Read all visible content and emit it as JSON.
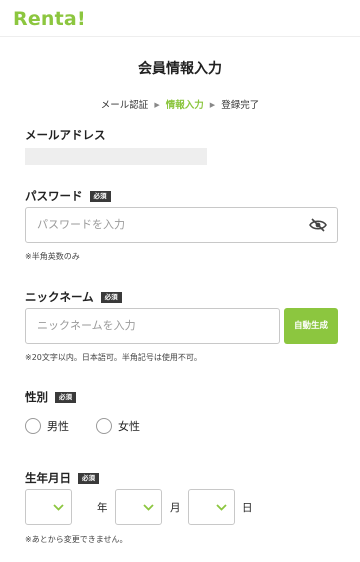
{
  "logo": {
    "text": "Renta!",
    "color": "#8cc63f"
  },
  "title": "会員情報入力",
  "steps": {
    "step1": "メール認証",
    "step2": "情報入力",
    "step3": "登録完了"
  },
  "required_badge": "必須",
  "email": {
    "label": "メールアドレス"
  },
  "password": {
    "label": "パスワード",
    "placeholder": "パスワードを入力",
    "note": "※半角英数のみ",
    "visibility_icon": "eye-slash-icon"
  },
  "nickname": {
    "label": "ニックネーム",
    "placeholder": "ニックネームを入力",
    "generate_button": "自動生成",
    "note": "※20文字以内。日本語可。半角記号は使用不可。"
  },
  "gender": {
    "label": "性別",
    "options": [
      "男性",
      "女性"
    ]
  },
  "birthday": {
    "label": "生年月日",
    "year_unit": "年",
    "month_unit": "月",
    "day_unit": "日",
    "note": "※あとから変更できません。"
  },
  "colors": {
    "accent": "#8cc63f",
    "badge": "#3a3a3a"
  }
}
